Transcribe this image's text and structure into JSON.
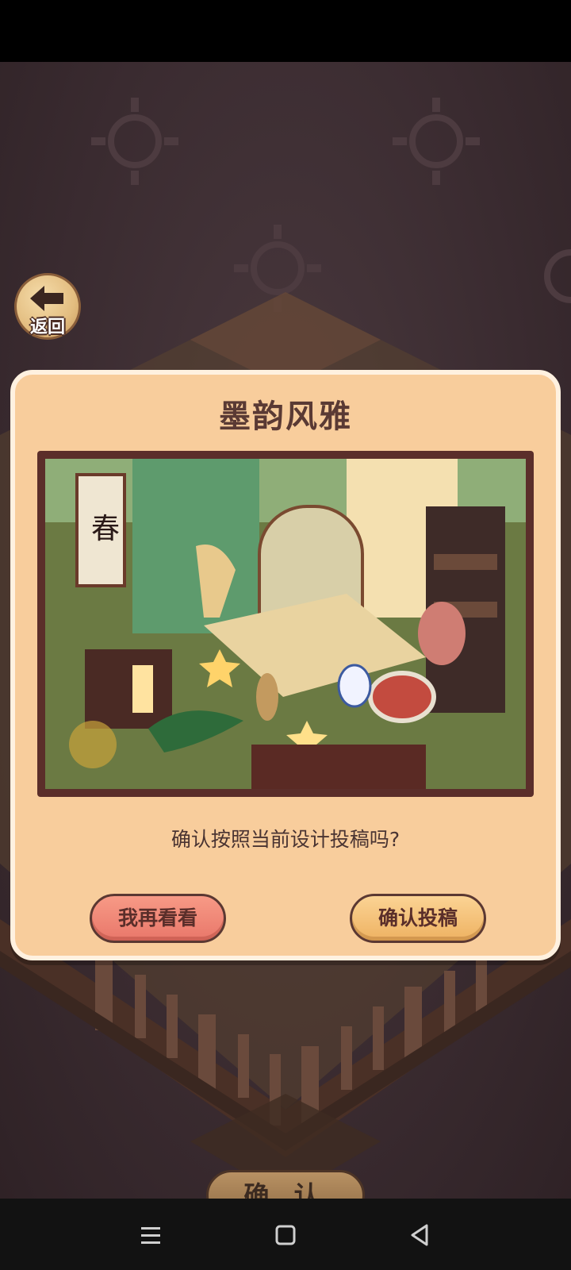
{
  "back_button": {
    "label": "返回"
  },
  "dialog": {
    "title": "墨韵风雅",
    "question": "确认按照当前设计投稿吗?",
    "cancel_label": "我再看看",
    "confirm_label": "确认投稿"
  },
  "bottom": {
    "confirm_label": "确 认"
  },
  "nav": {
    "icons": [
      "menu-icon",
      "home-icon",
      "back-triangle-icon"
    ]
  },
  "colors": {
    "dialog_bg": "#f8cd9c",
    "cancel_button": "#ee8474",
    "confirm_button": "#f3c07a",
    "title_text": "#5a3a34"
  }
}
